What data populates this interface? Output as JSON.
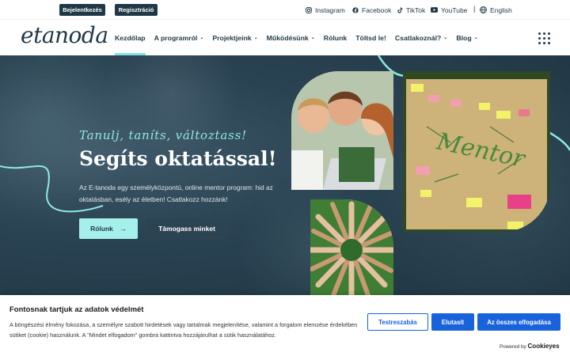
{
  "topbar": {
    "login_label": "Bejelentkezés",
    "register_label": "Regisztráció",
    "social": {
      "instagram": "Instagram",
      "facebook": "Facebook",
      "tiktok": "TikTok",
      "youtube": "YouTube"
    },
    "separator": "|",
    "language": "English"
  },
  "header": {
    "logo": "etanoda",
    "nav": [
      {
        "label": "Kezdőlap",
        "active": true,
        "has_dropdown": false
      },
      {
        "label": "A programról",
        "has_dropdown": true
      },
      {
        "label": "Projektjeink",
        "has_dropdown": true
      },
      {
        "label": "Működésünk",
        "has_dropdown": true
      },
      {
        "label": "Rólunk",
        "has_dropdown": false
      },
      {
        "label": "Töltsd le!",
        "has_dropdown": false
      },
      {
        "label": "Csatlakoznál?",
        "has_dropdown": true
      },
      {
        "label": "Blog",
        "has_dropdown": true
      }
    ],
    "dropdown_glyph": "⌄"
  },
  "hero": {
    "tagline": "Tanulj, taníts, változtass!",
    "title": "Segíts oktatással!",
    "description": "Az E-tanoda egy személyközpontú, online mentor program: hid az oktatásban, esély az életben! Csatlakozz hozzánk!",
    "primary_button": "Rólunk",
    "primary_arrow": "→",
    "secondary_button": "Támogass minket",
    "board_text": "Mentor"
  },
  "cookie": {
    "title": "Fontosnak tartjuk az adatok védelmét",
    "text": "A böngészési élmény fokozása, a személyre szabott hirdetések vagy tartalmak megjelenítése, valamint a forgalom elemzése érdekében sütiket (cookie) használunk. A \"Mindet elfogadom\" gombra kattintva hozzájárulhat a sütik használatához.",
    "customize": "Testreszabás",
    "reject": "Elutasít",
    "accept": "Az összes elfogadása",
    "powered_prefix": "Powered by",
    "powered_brand": "Cookieyes"
  },
  "colors": {
    "navy": "#1f3847",
    "accent": "#a6f0ec",
    "tagline": "#8fe8e2",
    "cookie_blue": "#1863dc"
  }
}
